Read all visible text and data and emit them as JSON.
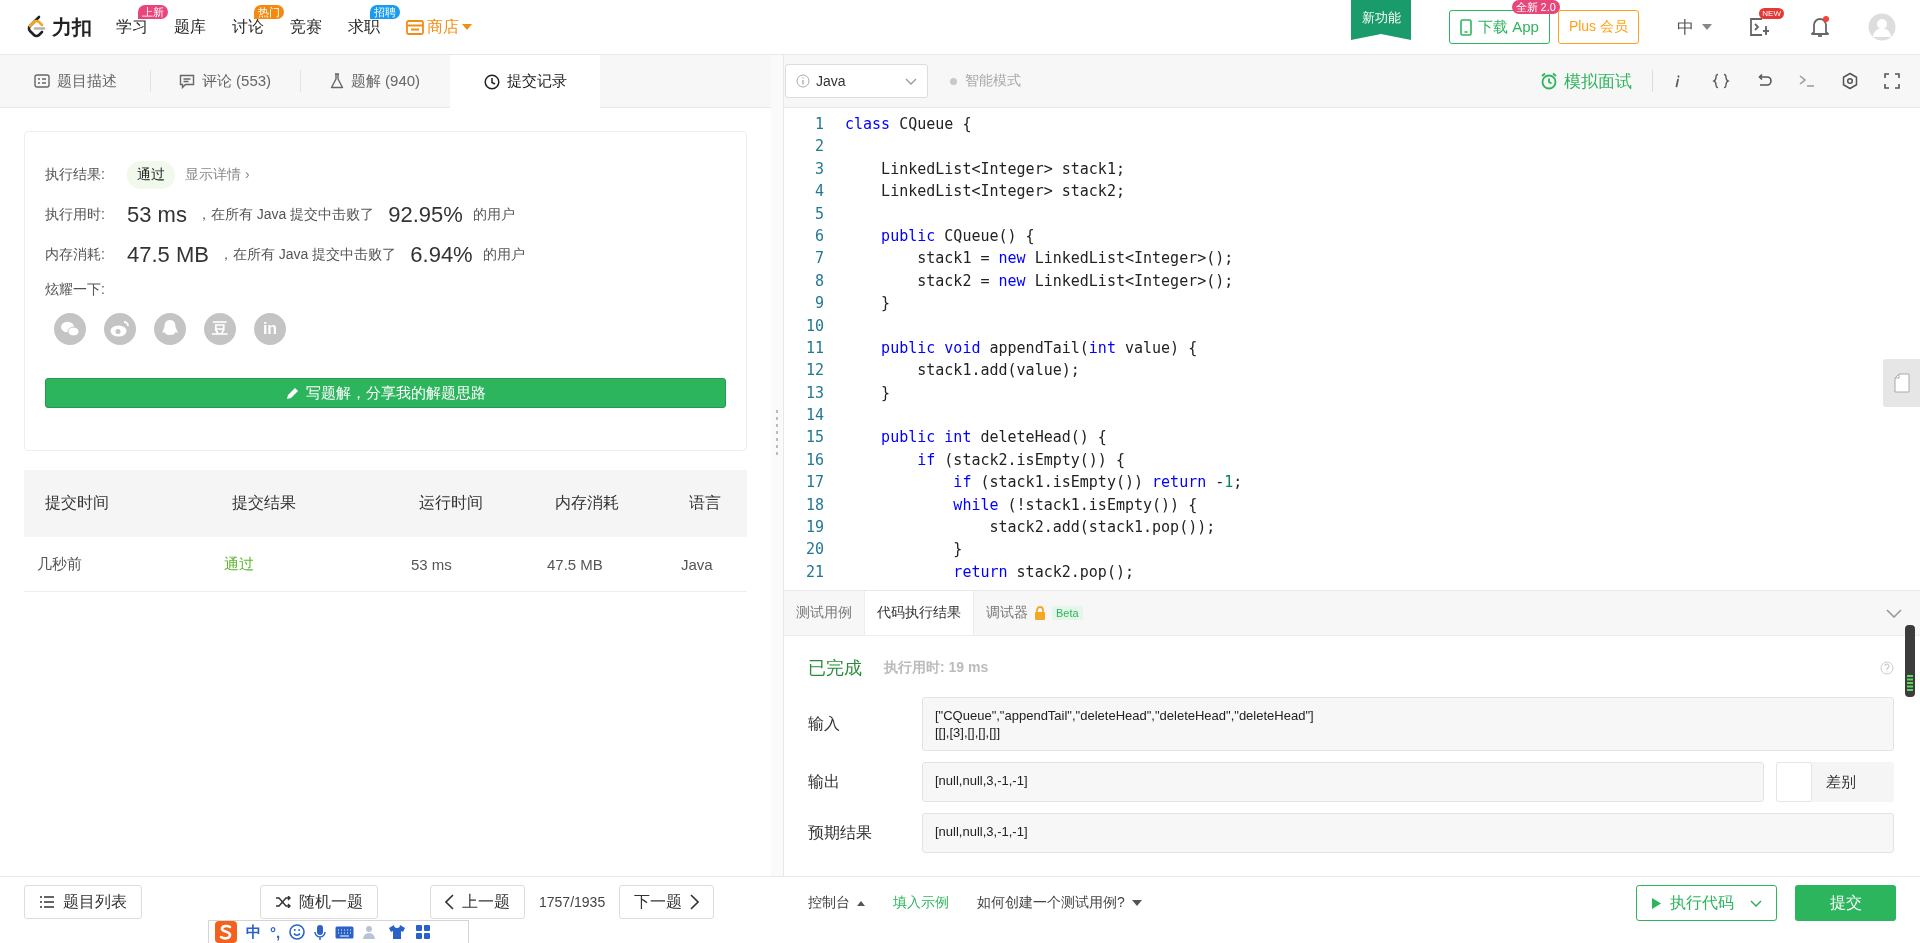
{
  "nav": {
    "logo": "力扣",
    "items": [
      {
        "label": "学习",
        "badge": {
          "label": "上新",
          "color": "#e8457a"
        }
      },
      {
        "label": "题库"
      },
      {
        "label": "讨论",
        "badge": {
          "label": "热门",
          "color": "#f5890f"
        }
      },
      {
        "label": "竞赛"
      },
      {
        "label": "求职",
        "badge": {
          "label": "招聘",
          "color": "#1a9bf0"
        }
      },
      {
        "label": "商店",
        "kind": "store"
      }
    ],
    "ribbon": "新功能",
    "download": {
      "label": "下载 App",
      "badge": "全新 2.0"
    },
    "plus": "Plus 会员",
    "language": "中",
    "playground_badge": "NEW",
    "notification_dot": true
  },
  "left_tabs": [
    {
      "label": "题目描述",
      "selected": false
    },
    {
      "label": "评论 (553)",
      "selected": false
    },
    {
      "label": "题解 (940)",
      "selected": false
    },
    {
      "label": "提交记录",
      "selected": true
    }
  ],
  "result": {
    "status_label": "执行结果:",
    "status": "通过",
    "details_link": "显示详情 ›",
    "stats": [
      {
        "label": "执行用时:",
        "value": "53 ms",
        "text": "，在所有 Java 提交中击败了",
        "percent": "92.95%",
        "suffix": "的用户"
      },
      {
        "label": "内存消耗:",
        "value": "47.5 MB",
        "text": "，在所有 Java 提交中击败了",
        "percent": "6.94%",
        "suffix": "的用户"
      }
    ],
    "share_label": "炫耀一下:",
    "share": [
      {
        "kind": "chat"
      },
      {
        "kind": "eye"
      },
      {
        "kind": "penguin"
      },
      {
        "kind": "text",
        "label": "豆"
      },
      {
        "kind": "text",
        "label": "in"
      }
    ],
    "write_button": "写题解，分享我的解题思路"
  },
  "table": {
    "columns": [
      "提交时间",
      "提交结果",
      "运行时间",
      "内存消耗",
      "语言"
    ],
    "rows": [
      [
        "几秒前",
        "通过",
        "53 ms",
        "47.5 MB",
        "Java"
      ]
    ]
  },
  "editor": {
    "language": "Java",
    "smart_mode": {
      "label": "智能模式",
      "enabled": false
    },
    "interview": "模拟面试",
    "lines": [
      {
        "no": "1",
        "tokens": [
          {
            "t": "class",
            "kind": "keyword"
          },
          {
            "t": " CQueue {",
            "kind": "plain"
          }
        ]
      },
      {
        "no": "2"
      },
      {
        "no": "3",
        "tokens": [
          {
            "t": "    LinkedList<Integer> stack1;",
            "kind": "plain"
          }
        ]
      },
      {
        "no": "4",
        "tokens": [
          {
            "t": "    LinkedList<Integer> stack2;",
            "kind": "plain"
          }
        ]
      },
      {
        "no": "5"
      },
      {
        "no": "6",
        "tokens": [
          {
            "t": "    public",
            "kind": "keyword"
          },
          {
            "t": " CQueue() {",
            "kind": "plain"
          }
        ]
      },
      {
        "no": "7",
        "tokens": [
          {
            "t": "        stack1 = ",
            "kind": "plain"
          },
          {
            "t": "new",
            "kind": "keyword"
          },
          {
            "t": " LinkedList<Integer>();",
            "kind": "plain"
          }
        ]
      },
      {
        "no": "8",
        "tokens": [
          {
            "t": "        stack2 = ",
            "kind": "plain"
          },
          {
            "t": "new",
            "kind": "keyword"
          },
          {
            "t": " LinkedList<Integer>();",
            "kind": "plain"
          }
        ]
      },
      {
        "no": "9",
        "tokens": [
          {
            "t": "    }",
            "kind": "plain"
          }
        ]
      },
      {
        "no": "10"
      },
      {
        "no": "11",
        "tokens": [
          {
            "t": "    public",
            "kind": "keyword"
          },
          {
            "t": " void",
            "kind": "keyword"
          },
          {
            "t": " appendTail(",
            "kind": "plain"
          },
          {
            "t": "int",
            "kind": "keyword"
          },
          {
            "t": " value) {",
            "kind": "plain"
          }
        ]
      },
      {
        "no": "12",
        "tokens": [
          {
            "t": "        stack1.add(value);",
            "kind": "plain"
          }
        ]
      },
      {
        "no": "13",
        "tokens": [
          {
            "t": "    }",
            "kind": "plain"
          }
        ]
      },
      {
        "no": "14"
      },
      {
        "no": "15",
        "tokens": [
          {
            "t": "    public",
            "kind": "keyword"
          },
          {
            "t": " int",
            "kind": "keyword"
          },
          {
            "t": " deleteHead() {",
            "kind": "plain"
          }
        ]
      },
      {
        "no": "16",
        "tokens": [
          {
            "t": "        if",
            "kind": "keyword"
          },
          {
            "t": " (stack2.isEmpty()) {",
            "kind": "plain"
          }
        ]
      },
      {
        "no": "17",
        "tokens": [
          {
            "t": "            if",
            "kind": "keyword"
          },
          {
            "t": " (stack1.isEmpty()) ",
            "kind": "plain"
          },
          {
            "t": "return",
            "kind": "keyword"
          },
          {
            "t": " -",
            "kind": "plain"
          },
          {
            "t": "1",
            "kind": "number"
          },
          {
            "t": ";",
            "kind": "plain"
          }
        ]
      },
      {
        "no": "18",
        "tokens": [
          {
            "t": "            while",
            "kind": "keyword"
          },
          {
            "t": " (!stack1.isEmpty()) {",
            "kind": "plain"
          }
        ]
      },
      {
        "no": "19",
        "tokens": [
          {
            "t": "                stack2.add(stack1.pop());",
            "kind": "plain"
          }
        ]
      },
      {
        "no": "20",
        "tokens": [
          {
            "t": "            }",
            "kind": "plain"
          }
        ]
      },
      {
        "no": "21",
        "tokens": [
          {
            "t": "            return",
            "kind": "keyword"
          },
          {
            "t": " stack2.pop();",
            "kind": "plain"
          }
        ]
      }
    ]
  },
  "console": {
    "tabs": [
      {
        "label": "测试用例",
        "selected": false
      },
      {
        "label": "代码执行结果",
        "selected": true
      },
      {
        "label": "调试器",
        "locked": true,
        "badge": "Beta",
        "selected": false
      }
    ],
    "status": "已完成",
    "runtime": "执行用时: 19 ms",
    "input_label": "输入",
    "input_lines": [
      "[\"CQueue\",\"appendTail\",\"deleteHead\",\"deleteHead\",\"deleteHead\"]",
      "[[],[3],[],[],[]]"
    ],
    "output_label": "输出",
    "output": "[null,null,3,-1,-1]",
    "diff": {
      "label": "差别",
      "on": false
    },
    "expected_label": "预期结果",
    "expected": "[null,null,3,-1,-1]"
  },
  "bottom": {
    "list_button": "题目列表",
    "random_button": "随机一题",
    "prev_button": "上一题",
    "position": "1757/1935",
    "next_button": "下一题",
    "console_toggle": "控制台",
    "example_link": "填入示例",
    "help_link": "如何创建一个测试用例?",
    "run_button": "执行代码",
    "submit_button": "提交"
  },
  "ime": {
    "mode": "中",
    "punct": "°,"
  }
}
